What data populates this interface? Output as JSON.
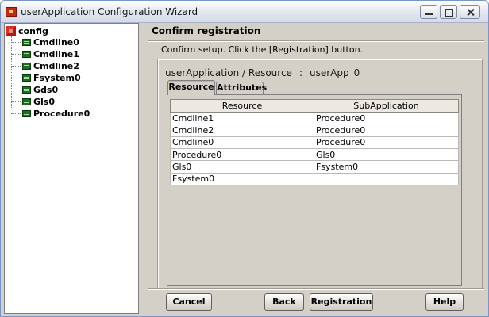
{
  "window": {
    "title": "userApplication Configuration Wizard"
  },
  "tree": {
    "root": "config",
    "items": [
      "Cmdline0",
      "Cmdline1",
      "Cmdline2",
      "Fsystem0",
      "Gds0",
      "Gls0",
      "Procedure0"
    ]
  },
  "main": {
    "heading": "Confirm registration",
    "instruction": "Confirm setup.  Click the [Registration] button.",
    "resource_label": "userApplication / Resource",
    "resource_separator": ":",
    "resource_value": "userApp_0",
    "tabs": [
      {
        "label": "Resource",
        "active": true
      },
      {
        "label": "Attributes",
        "active": false
      }
    ],
    "table": {
      "headers": [
        "Resource",
        "SubApplication"
      ],
      "rows": [
        [
          "Cmdline1",
          "Procedure0"
        ],
        [
          "Cmdline2",
          "Procedure0"
        ],
        [
          "Cmdline0",
          "Procedure0"
        ],
        [
          "Procedure0",
          "Gls0"
        ],
        [
          "Gls0",
          "Fsystem0"
        ],
        [
          "Fsystem0",
          ""
        ]
      ]
    }
  },
  "buttons": {
    "cancel": "Cancel",
    "back": "Back",
    "registration": "Registration",
    "help": "Help"
  },
  "icons": {
    "app": "app-icon",
    "root": "config-root-icon",
    "resource": "resource-icon"
  },
  "colors": {
    "window_bg": "#d4d0c8",
    "active_tab_accent": "#f0b030",
    "resource_icon": "#1f6b22",
    "root_icon": "#e03020"
  }
}
